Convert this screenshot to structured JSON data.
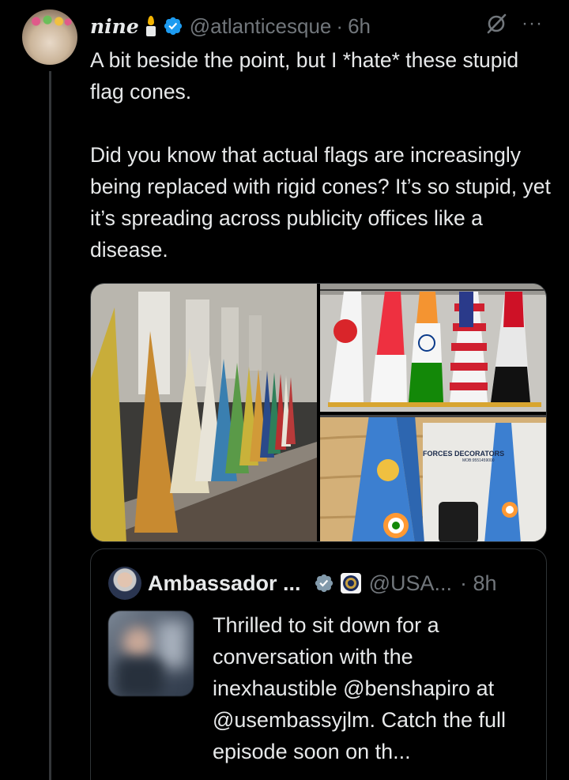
{
  "tweet": {
    "display_name": "nine",
    "handle": "@atlanticesque",
    "separator": "·",
    "time": "6h",
    "text_p1": "A bit beside the point, but I *hate* these stupid flag cones.",
    "text_p2": "Did you know that actual flags are increasingly being replaced with rigid cones? It’s so stupid, yet it’s spreading across publicity offices like a disease.",
    "icons": {
      "badge": "candle-icon",
      "verified": "verified-badge-icon",
      "grok": "grok-icon",
      "more": "more-icon"
    },
    "media": {
      "bottom_right_sign": "FORCES DECORATORS",
      "bottom_right_sign_small": "MOB:9551459000"
    }
  },
  "quote": {
    "name": "Ambassador ...",
    "handle": "@USA...",
    "time": "· 8h",
    "text": "Thrilled to sit down for a conversation with the inexhaustible @benshapiro at @usembassyjlm. Catch the full episode soon on th...",
    "icons": {
      "verified": "verified-badge-icon",
      "affiliation": "us-seal-icon"
    }
  },
  "colors": {
    "background": "#000000",
    "text": "#e7e9ea",
    "muted": "#71767b",
    "verified": "#1d9bf0",
    "gray_badge": "#829aab"
  }
}
